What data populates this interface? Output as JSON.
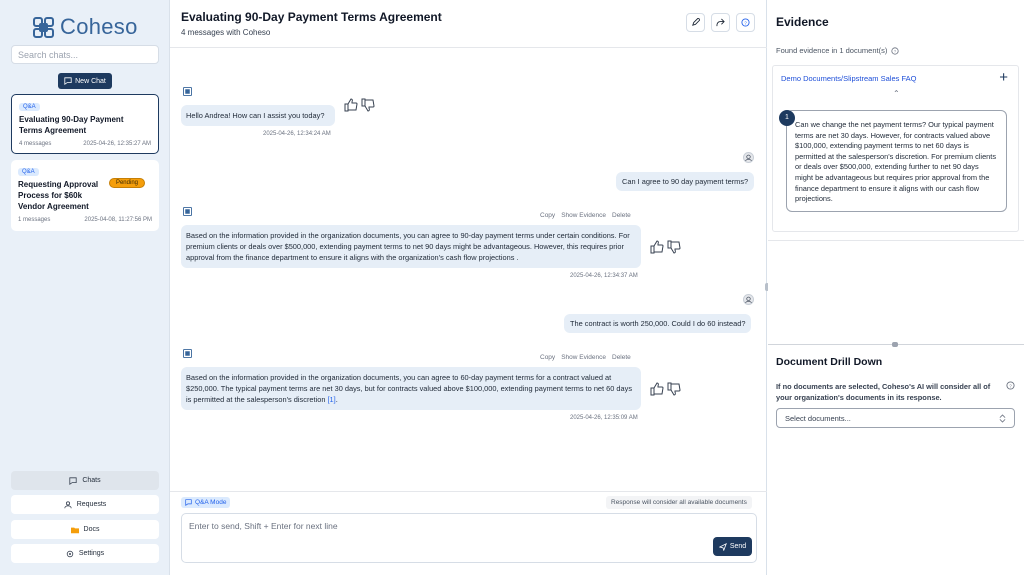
{
  "app": {
    "name": "Coheso"
  },
  "sidebar": {
    "search_placeholder": "Search chats...",
    "new_chat_label": "New Chat",
    "chats": [
      {
        "tag": "Q&A",
        "title": "Evaluating 90-Day Payment Terms Agreement",
        "messages": "4 messages",
        "timestamp": "2025-04-26, 12:35:27 AM",
        "active": true
      },
      {
        "tag": "Q&A",
        "title": "Requesting Approval Process for $60k Vendor Agreement",
        "messages": "1 messages",
        "timestamp": "2025-04-08, 11:27:56 PM",
        "status": "Pending"
      }
    ],
    "nav": [
      {
        "label": "Chats",
        "icon": "chat-icon"
      },
      {
        "label": "Requests",
        "icon": "user-icon"
      },
      {
        "label": "Docs",
        "icon": "folder-icon"
      },
      {
        "label": "Settings",
        "icon": "gear-icon"
      }
    ]
  },
  "conversation": {
    "title": "Evaluating 90-Day Payment Terms Agreement",
    "subtitle": "4 messages with Coheso",
    "header_icons": [
      "edit-icon",
      "share-icon",
      "help-icon"
    ],
    "messages": [
      {
        "role": "assistant",
        "text": "Hello Andrea! How can I assist you today?",
        "timestamp": "2025-04-26, 12:34:24 AM"
      },
      {
        "role": "user",
        "text": "Can I agree to 90 day payment terms?"
      },
      {
        "role": "assistant",
        "text": "Based on the information provided in the organization documents, you can agree to 90-day payment terms under certain conditions. For premium clients or deals over $500,000, extending payment terms to net 90 days might be advantageous. However, this requires prior approval from the finance department to ensure it aligns with the organization's cash flow projections .",
        "timestamp": "2025-04-26, 12:34:37 AM"
      },
      {
        "role": "user",
        "text": "The contract is worth 250,000. Could I do 60 instead?"
      },
      {
        "role": "assistant",
        "text": "Based on the information provided in the organization documents, you can agree to 60-day payment terms for a contract valued at $250,000. The typical payment terms are net 30 days, but for contracts valued above $100,000, extending payment terms to net 60 days is permitted at the salesperson's discretion ",
        "citation": "[1]",
        "text_end": ".",
        "timestamp": "2025-04-26, 12:35:09 AM"
      }
    ],
    "actions": {
      "copy": "Copy",
      "show_evidence": "Show Evidence",
      "delete": "Delete"
    }
  },
  "composer": {
    "mode_label": "Q&A Mode",
    "consider_note": "Response will consider all available documents",
    "placeholder": "Enter to send, Shift + Enter for next line",
    "send_label": "Send"
  },
  "evidence": {
    "title": "Evidence",
    "found_text": "Found evidence in 1 document(s)",
    "document": "Demo Documents/Slipstream Sales FAQ",
    "citation_number": "1",
    "quote": "Can we change the net payment terms? Our typical payment terms are net 30 days. However, for contracts valued above $100,000, extending payment terms to net 60 days is permitted at the salesperson's discretion. For premium clients or deals over $500,000, extending further to net 90 days might be advantageous but requires prior approval from the finance department to ensure it aligns with our cash flow projections."
  },
  "drill_down": {
    "title": "Document Drill Down",
    "note": "If no documents are selected, Coheso's AI will consider all of your organization's documents in its response.",
    "select_placeholder": "Select documents..."
  },
  "colors": {
    "brand": "#1e3a5f",
    "accent": "#2563eb",
    "pending": "#f59e0b",
    "sidebar_bg": "#e9f0f8",
    "bubble_bg": "#e6eef7"
  }
}
